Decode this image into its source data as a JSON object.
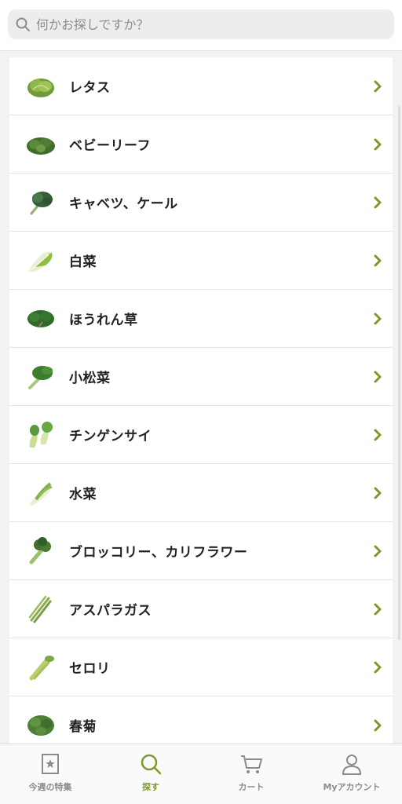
{
  "search": {
    "placeholder": "何かお探しですか？"
  },
  "categories": [
    {
      "label": "レタス",
      "icon": "lettuce-icon"
    },
    {
      "label": "ベビーリーフ",
      "icon": "baby-leaf-icon"
    },
    {
      "label": "キャベツ、ケール",
      "icon": "kale-icon"
    },
    {
      "label": "白菜",
      "icon": "napa-cabbage-icon"
    },
    {
      "label": "ほうれん草",
      "icon": "spinach-icon"
    },
    {
      "label": "小松菜",
      "icon": "komatsuna-icon"
    },
    {
      "label": "チンゲンサイ",
      "icon": "bok-choy-icon"
    },
    {
      "label": "水菜",
      "icon": "mizuna-icon"
    },
    {
      "label": "ブロッコリー、カリフラワー",
      "icon": "broccoli-icon"
    },
    {
      "label": "アスパラガス",
      "icon": "asparagus-icon"
    },
    {
      "label": "セロリ",
      "icon": "celery-icon"
    },
    {
      "label": "春菊",
      "icon": "shungiku-icon"
    }
  ],
  "tabs": [
    {
      "label": "今週の特集",
      "icon": "star-bookmark-icon",
      "active": false
    },
    {
      "label": "探す",
      "icon": "search-icon",
      "active": true
    },
    {
      "label": "カート",
      "icon": "cart-icon",
      "active": false
    },
    {
      "label": "Myアカウント",
      "icon": "person-icon",
      "active": false
    }
  ],
  "colors": {
    "accent": "#7a9a2a",
    "chevron": "#7a9a2a",
    "inactive": "#8c8c8c"
  }
}
